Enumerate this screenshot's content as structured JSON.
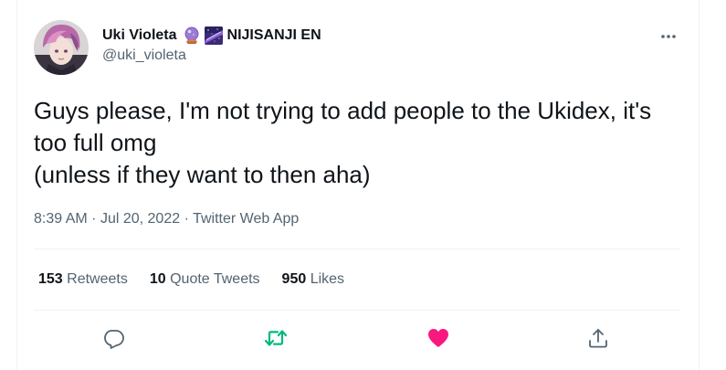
{
  "author": {
    "display_name": "Uki Violeta",
    "emoji_1": "crystal-ball",
    "emoji_2": "milky-way",
    "affiliation": "NIJISANJI EN",
    "handle": "@uki_violeta"
  },
  "tweet": {
    "text": "Guys please, I'm not trying to add people to the Ukidex, it's too full omg\n(unless if they want to then aha)",
    "time": "8:39 AM",
    "date": "Jul 20, 2022",
    "source": "Twitter Web App",
    "separator": "·"
  },
  "stats": {
    "retweets": {
      "count": "153",
      "label": "Retweets"
    },
    "quote_tweets": {
      "count": "10",
      "label": "Quote Tweets"
    },
    "likes": {
      "count": "950",
      "label": "Likes"
    }
  },
  "actions": [
    {
      "name": "reply",
      "icon": "reply-icon",
      "color": "#536471"
    },
    {
      "name": "retweet",
      "icon": "retweet-icon",
      "color": "#00ba7c",
      "active": true
    },
    {
      "name": "like",
      "icon": "heart-icon",
      "color": "#f91880",
      "active": true
    },
    {
      "name": "share",
      "icon": "share-icon",
      "color": "#536471"
    }
  ],
  "colors": {
    "text_primary": "#0f1419",
    "text_secondary": "#536471",
    "divider": "#eff3f4",
    "retweet_green": "#00ba7c",
    "like_pink": "#f91880"
  }
}
